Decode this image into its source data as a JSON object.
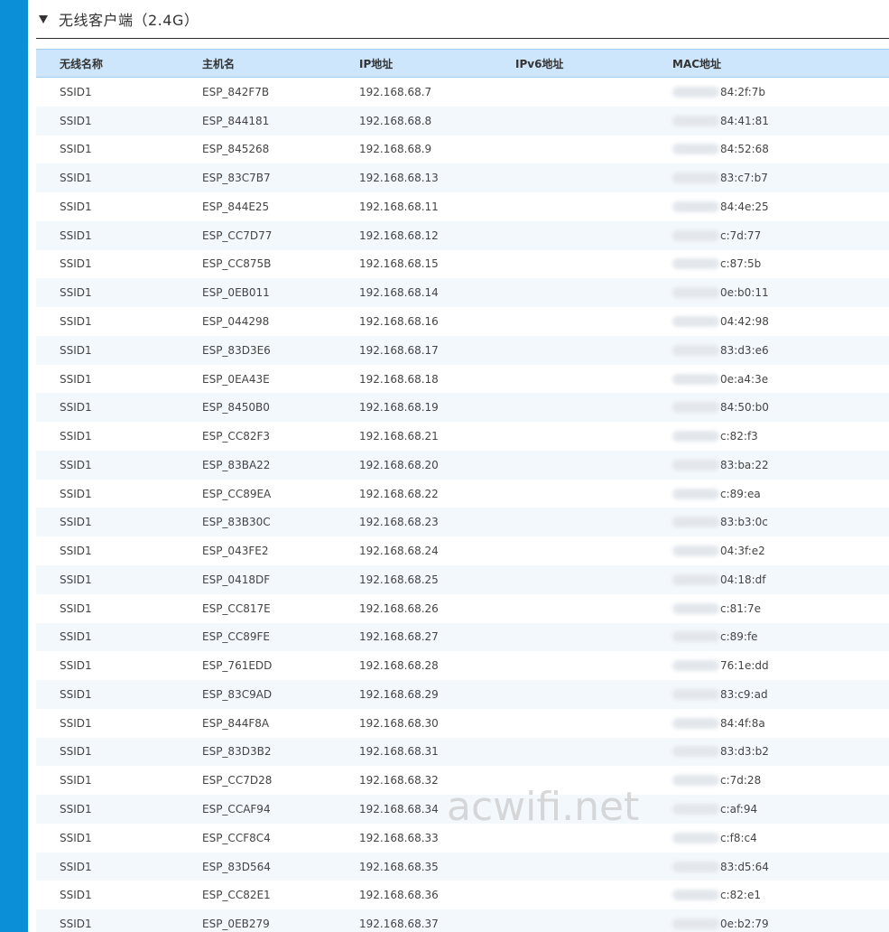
{
  "section": {
    "title": "无线客户端（2.4G）"
  },
  "table": {
    "headers": [
      "无线名称",
      "主机名",
      "IP地址",
      "IPv6地址",
      "MAC地址"
    ],
    "rows": [
      {
        "ssid": "SSID1",
        "host": "ESP_842F7B",
        "ip": "192.168.68.7",
        "ipv6": "",
        "mac": "84:2f:7b"
      },
      {
        "ssid": "SSID1",
        "host": "ESP_844181",
        "ip": "192.168.68.8",
        "ipv6": "",
        "mac": "84:41:81"
      },
      {
        "ssid": "SSID1",
        "host": "ESP_845268",
        "ip": "192.168.68.9",
        "ipv6": "",
        "mac": "84:52:68"
      },
      {
        "ssid": "SSID1",
        "host": "ESP_83C7B7",
        "ip": "192.168.68.13",
        "ipv6": "",
        "mac": "83:c7:b7"
      },
      {
        "ssid": "SSID1",
        "host": "ESP_844E25",
        "ip": "192.168.68.11",
        "ipv6": "",
        "mac": "84:4e:25"
      },
      {
        "ssid": "SSID1",
        "host": "ESP_CC7D77",
        "ip": "192.168.68.12",
        "ipv6": "",
        "mac": "c:7d:77"
      },
      {
        "ssid": "SSID1",
        "host": "ESP_CC875B",
        "ip": "192.168.68.15",
        "ipv6": "",
        "mac": "c:87:5b"
      },
      {
        "ssid": "SSID1",
        "host": "ESP_0EB011",
        "ip": "192.168.68.14",
        "ipv6": "",
        "mac": "0e:b0:11"
      },
      {
        "ssid": "SSID1",
        "host": "ESP_044298",
        "ip": "192.168.68.16",
        "ipv6": "",
        "mac": "04:42:98"
      },
      {
        "ssid": "SSID1",
        "host": "ESP_83D3E6",
        "ip": "192.168.68.17",
        "ipv6": "",
        "mac": "83:d3:e6"
      },
      {
        "ssid": "SSID1",
        "host": "ESP_0EA43E",
        "ip": "192.168.68.18",
        "ipv6": "",
        "mac": "0e:a4:3e"
      },
      {
        "ssid": "SSID1",
        "host": "ESP_8450B0",
        "ip": "192.168.68.19",
        "ipv6": "",
        "mac": "84:50:b0"
      },
      {
        "ssid": "SSID1",
        "host": "ESP_CC82F3",
        "ip": "192.168.68.21",
        "ipv6": "",
        "mac": "c:82:f3"
      },
      {
        "ssid": "SSID1",
        "host": "ESP_83BA22",
        "ip": "192.168.68.20",
        "ipv6": "",
        "mac": "83:ba:22"
      },
      {
        "ssid": "SSID1",
        "host": "ESP_CC89EA",
        "ip": "192.168.68.22",
        "ipv6": "",
        "mac": "c:89:ea"
      },
      {
        "ssid": "SSID1",
        "host": "ESP_83B30C",
        "ip": "192.168.68.23",
        "ipv6": "",
        "mac": "83:b3:0c"
      },
      {
        "ssid": "SSID1",
        "host": "ESP_043FE2",
        "ip": "192.168.68.24",
        "ipv6": "",
        "mac": "04:3f:e2"
      },
      {
        "ssid": "SSID1",
        "host": "ESP_0418DF",
        "ip": "192.168.68.25",
        "ipv6": "",
        "mac": "04:18:df"
      },
      {
        "ssid": "SSID1",
        "host": "ESP_CC817E",
        "ip": "192.168.68.26",
        "ipv6": "",
        "mac": "c:81:7e"
      },
      {
        "ssid": "SSID1",
        "host": "ESP_CC89FE",
        "ip": "192.168.68.27",
        "ipv6": "",
        "mac": "c:89:fe"
      },
      {
        "ssid": "SSID1",
        "host": "ESP_761EDD",
        "ip": "192.168.68.28",
        "ipv6": "",
        "mac": "76:1e:dd"
      },
      {
        "ssid": "SSID1",
        "host": "ESP_83C9AD",
        "ip": "192.168.68.29",
        "ipv6": "",
        "mac": "83:c9:ad"
      },
      {
        "ssid": "SSID1",
        "host": "ESP_844F8A",
        "ip": "192.168.68.30",
        "ipv6": "",
        "mac": "84:4f:8a"
      },
      {
        "ssid": "SSID1",
        "host": "ESP_83D3B2",
        "ip": "192.168.68.31",
        "ipv6": "",
        "mac": "83:d3:b2"
      },
      {
        "ssid": "SSID1",
        "host": "ESP_CC7D28",
        "ip": "192.168.68.32",
        "ipv6": "",
        "mac": "c:7d:28"
      },
      {
        "ssid": "SSID1",
        "host": "ESP_CCAF94",
        "ip": "192.168.68.34",
        "ipv6": "",
        "mac": "c:af:94"
      },
      {
        "ssid": "SSID1",
        "host": "ESP_CCF8C4",
        "ip": "192.168.68.33",
        "ipv6": "",
        "mac": "c:f8:c4"
      },
      {
        "ssid": "SSID1",
        "host": "ESP_83D564",
        "ip": "192.168.68.35",
        "ipv6": "",
        "mac": "83:d5:64"
      },
      {
        "ssid": "SSID1",
        "host": "ESP_CC82E1",
        "ip": "192.168.68.36",
        "ipv6": "",
        "mac": "c:82:e1"
      },
      {
        "ssid": "SSID1",
        "host": "ESP_0EB279",
        "ip": "192.168.68.37",
        "ipv6": "",
        "mac": "0e:b2:79"
      }
    ]
  },
  "watermark": "acwifi.net",
  "colors": {
    "sidebar": "#0b8fd6",
    "header_bg": "#cde6fb",
    "row_alt": "#f3f8fd"
  }
}
